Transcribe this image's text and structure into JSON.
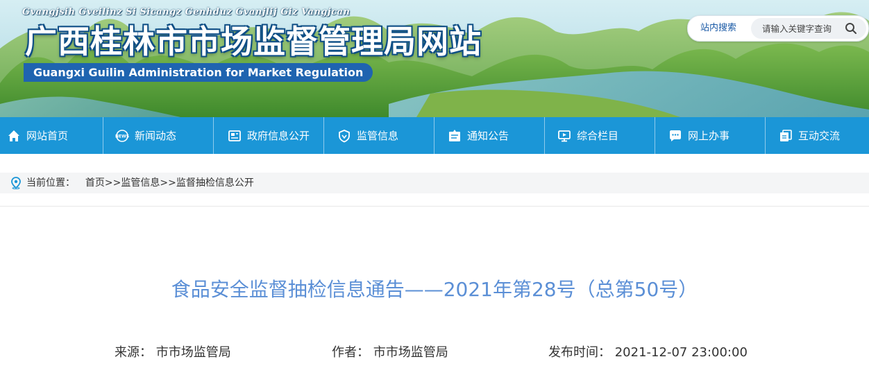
{
  "header": {
    "pinyin": "Gvangjsih Gveilinz Si Sicangz Genhduz Gvanjlij Giz Vangjcan",
    "title": "广西桂林市市场监督管理局网站",
    "subtitle": "Guangxi Guilin Administration for Market Regulation",
    "search_label": "站内搜索",
    "search_placeholder": "请输入关键字查询",
    "search_icon": "magnifier-icon"
  },
  "nav": [
    {
      "label": "网站首页",
      "icon": "home-icon"
    },
    {
      "label": "新闻动态",
      "icon": "news-icon"
    },
    {
      "label": "政府信息公开",
      "icon": "document-icon"
    },
    {
      "label": "监管信息",
      "icon": "shield-icon"
    },
    {
      "label": "通知公告",
      "icon": "announcement-icon"
    },
    {
      "label": "综合栏目",
      "icon": "monitor-icon"
    },
    {
      "label": "网上办事",
      "icon": "chat-icon"
    },
    {
      "label": "互动交流",
      "icon": "copy-icon"
    }
  ],
  "breadcrumb": {
    "prefix": "当前位置：",
    "items": [
      "首页",
      "监管信息",
      "监督抽检信息公开"
    ],
    "separator": ">>"
  },
  "article": {
    "title": "食品安全监督抽检信息通告——2021年第28号（总第50号）",
    "source_label": "来源：",
    "source_value": "市市场监管局",
    "author_label": "作者：",
    "author_value": "市市场监管局",
    "time_label": "发布时间：",
    "time_value": "2021-12-07 23:00:00"
  },
  "colors": {
    "nav_bg": "#1b96d7",
    "title_blue": "#5b8fd6",
    "subtitle_bg": "#1f64b0"
  }
}
